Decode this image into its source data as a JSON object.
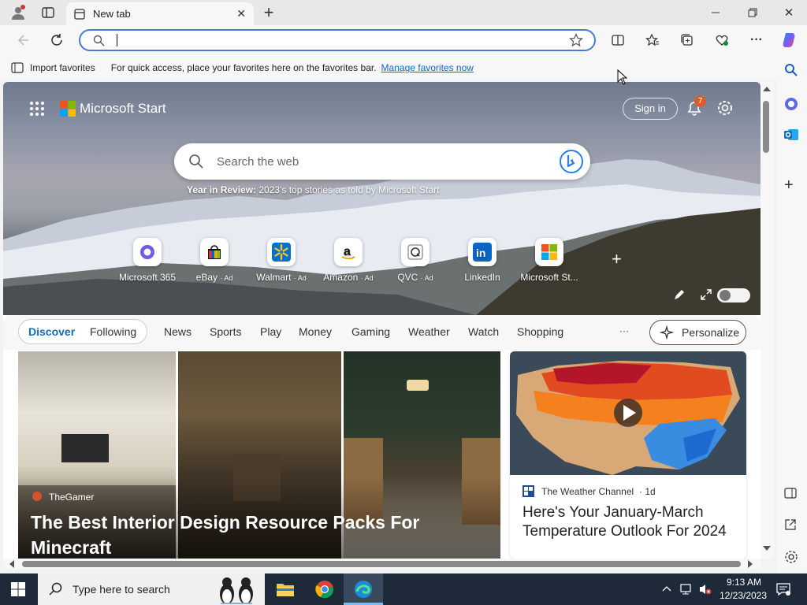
{
  "browser": {
    "tab_title": "New tab",
    "address_value": "",
    "favbar": {
      "import_label": "Import favorites",
      "hint_text": "For quick access, place your favorites here on the favorites bar.",
      "manage_link": "Manage favorites now"
    }
  },
  "start": {
    "brand": "Microsoft Start",
    "sign_in": "Sign in",
    "notification_count": "7",
    "search_placeholder": "Search the web",
    "year_review_bold": "Year in Review:",
    "year_review_text": " 2023's top stories as told by Microsoft Start",
    "tiles": [
      {
        "label": "Microsoft 365",
        "ad": ""
      },
      {
        "label": "eBay",
        "ad": "· Ad"
      },
      {
        "label": "Walmart",
        "ad": "· Ad"
      },
      {
        "label": "Amazon",
        "ad": "· Ad"
      },
      {
        "label": "QVC",
        "ad": "· Ad"
      },
      {
        "label": "LinkedIn",
        "ad": ""
      },
      {
        "label": "Microsoft St...",
        "ad": ""
      }
    ],
    "nav": {
      "discover": "Discover",
      "following": "Following",
      "news": "News",
      "sports": "Sports",
      "play": "Play",
      "money": "Money",
      "gaming": "Gaming",
      "weather": "Weather",
      "watch": "Watch",
      "shopping": "Shopping",
      "more": "···",
      "personalize": "Personalize"
    },
    "card1": {
      "source": "TheGamer",
      "title": "The Best Interior Design Resource Packs For Minecraft"
    },
    "card2": {
      "source": "The Weather Channel",
      "age": "· 1d",
      "title": "Here's Your January-March Temperature Outlook For 2024"
    }
  },
  "taskbar": {
    "search_placeholder": "Type here to search",
    "time": "9:13 AM",
    "date": "12/23/2023"
  },
  "colors": {
    "accent": "#0f6cbd",
    "address_border": "#4a7ad8",
    "taskbar": "#1e2a3a"
  }
}
